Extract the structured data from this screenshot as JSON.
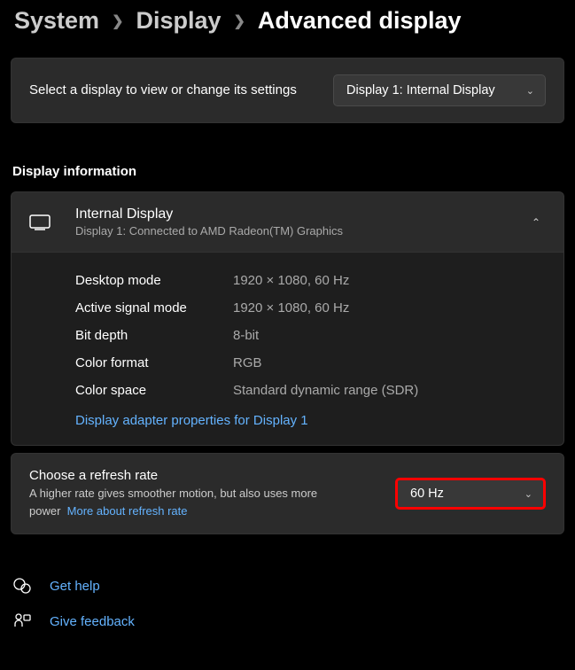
{
  "breadcrumb": {
    "a": "System",
    "b": "Display",
    "c": "Advanced display"
  },
  "selectDisplay": {
    "label": "Select a display to view or change its settings",
    "value": "Display 1: Internal Display"
  },
  "sectionTitle": "Display information",
  "info": {
    "title": "Internal Display",
    "subtitle": "Display 1: Connected to AMD Radeon(TM) Graphics",
    "rows": {
      "desktopMode": {
        "k": "Desktop mode",
        "v": "1920 × 1080, 60 Hz"
      },
      "activeSignal": {
        "k": "Active signal mode",
        "v": "1920 × 1080, 60 Hz"
      },
      "bitDepth": {
        "k": "Bit depth",
        "v": "8-bit"
      },
      "colorFormat": {
        "k": "Color format",
        "v": "RGB"
      },
      "colorSpace": {
        "k": "Color space",
        "v": "Standard dynamic range (SDR)"
      }
    },
    "adapterLink": "Display adapter properties for Display 1"
  },
  "refresh": {
    "title": "Choose a refresh rate",
    "subtitle": "A higher rate gives smoother motion, but also uses more power",
    "moreLink": "More about refresh rate",
    "value": "60 Hz"
  },
  "help": {
    "getHelp": "Get help",
    "feedback": "Give feedback"
  }
}
